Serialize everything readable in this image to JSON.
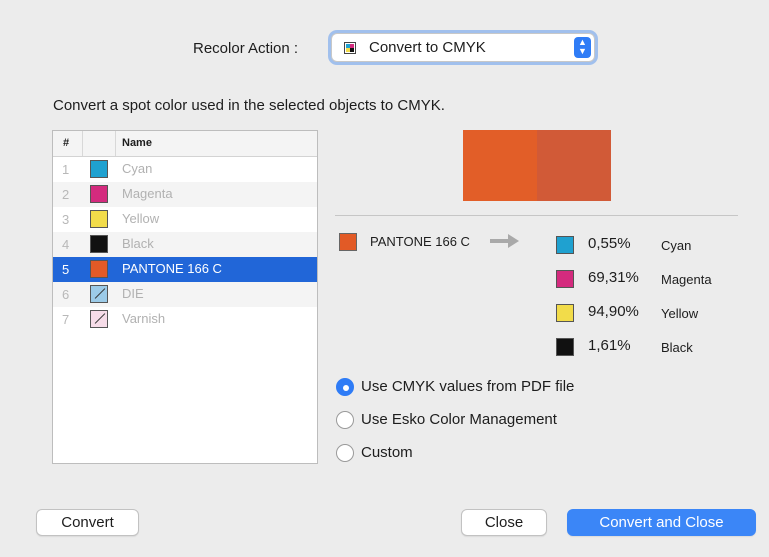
{
  "recolor": {
    "label": "Recolor Action :",
    "selected": "Convert to CMYK"
  },
  "description": "Convert a spot color used in the selected objects to CMYK.",
  "table": {
    "headers": [
      "#",
      "",
      "Name"
    ],
    "rows": [
      {
        "num": "1",
        "name": "Cyan",
        "color": "#1fa1d0"
      },
      {
        "num": "2",
        "name": "Magenta",
        "color": "#d42b7e"
      },
      {
        "num": "3",
        "name": "Yellow",
        "color": "#f2dc4a"
      },
      {
        "num": "4",
        "name": "Black",
        "color": "#111111"
      },
      {
        "num": "5",
        "name": "PANTONE 166 C",
        "color": "#e25a26"
      },
      {
        "num": "6",
        "name": "DIE",
        "color": "#9ccbe8"
      },
      {
        "num": "7",
        "name": "Varnish",
        "color": "#f6dce8"
      }
    ]
  },
  "preview": {
    "left_color": "#e25e28",
    "right_color": "#d15a37"
  },
  "spot": {
    "name": "PANTONE 166 C",
    "color": "#e25a26"
  },
  "cmyk": [
    {
      "pct": "0,55%",
      "name": "Cyan",
      "color": "#1fa1d0"
    },
    {
      "pct": "69,31%",
      "name": "Magenta",
      "color": "#d42b7e"
    },
    {
      "pct": "94,90%",
      "name": "Yellow",
      "color": "#f2dc4a"
    },
    {
      "pct": "1,61%",
      "name": "Black",
      "color": "#111111"
    }
  ],
  "options": [
    {
      "label": "Use CMYK values from PDF file",
      "selected": true
    },
    {
      "label": "Use Esko Color Management",
      "selected": false
    },
    {
      "label": "Custom",
      "selected": false
    }
  ],
  "buttons": {
    "convert": "Convert",
    "close": "Close",
    "convert_close": "Convert and Close"
  }
}
